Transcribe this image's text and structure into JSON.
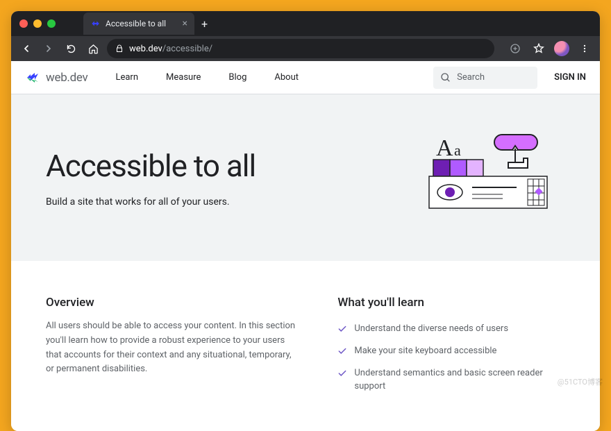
{
  "browser": {
    "tab_title": "Accessible to all",
    "url_host": "web.dev",
    "url_path": "/accessible/"
  },
  "site": {
    "brand": "web.dev",
    "nav": {
      "learn": "Learn",
      "measure": "Measure",
      "blog": "Blog",
      "about": "About"
    },
    "search_placeholder": "Search",
    "signin": "SIGN IN"
  },
  "hero": {
    "title": "Accessible to all",
    "subtitle": "Build a site that works for all of your users."
  },
  "overview": {
    "heading": "Overview",
    "body": "All users should be able to access your content. In this section you'll learn how to provide a robust experience to your users that accounts for their context and any situational, temporary, or permanent disabilities."
  },
  "learn": {
    "heading": "What you'll learn",
    "items": [
      "Understand the diverse needs of users",
      "Make your site keyboard accessible",
      "Understand semantics and basic screen reader support"
    ]
  },
  "watermark": "@51CTO博客"
}
